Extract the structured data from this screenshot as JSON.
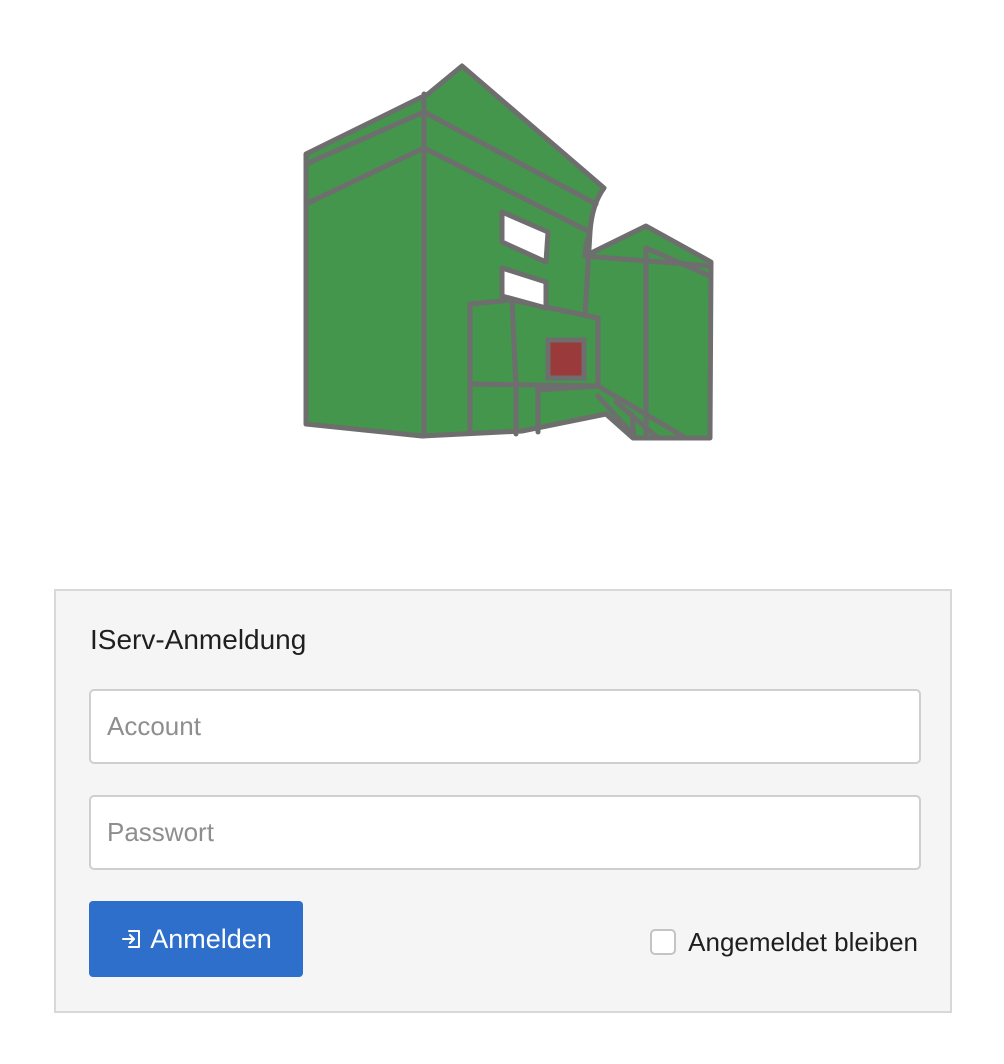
{
  "login": {
    "title": "IServ-Anmeldung",
    "account_placeholder": "Account",
    "password_placeholder": "Passwort",
    "submit_label": "Anmelden",
    "submit_icon": "sign-in-icon",
    "remember_label": "Angemeldet bleiben",
    "remember_checked": false
  },
  "logo": {
    "icon": "school-building-logo",
    "colors": {
      "fill": "#43964b",
      "outline": "#6e6e6e",
      "door": "#9a3a3a"
    }
  },
  "colors": {
    "primary": "#2e6fcc",
    "panel_background": "#f5f5f5"
  }
}
